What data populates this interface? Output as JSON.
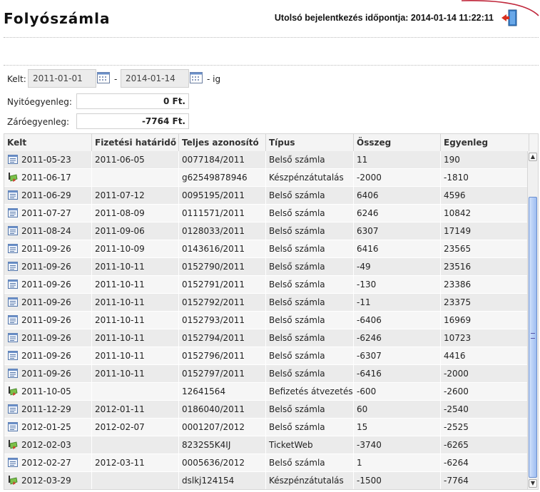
{
  "page": {
    "title": "Folyószámla",
    "last_login_label": "Utolsó bejelentkezés időpontja:",
    "last_login_value": "2014-01-14 11:22:11"
  },
  "filter": {
    "kelt_label": "Kelt:",
    "date_from": "2011-01-01",
    "separator": "-",
    "date_to": "2014-01-14",
    "suffix": "- ig",
    "opening_label": "Nyitóegyenleg:",
    "opening_value": "0 Ft.",
    "closing_label": "Záróegyenleg:",
    "closing_value": "-7764 Ft."
  },
  "table": {
    "columns": [
      "Kelt",
      "Fizetési határidő",
      "Teljes azonosító",
      "Típus",
      "Összeg",
      "Egyenleg"
    ],
    "rows": [
      {
        "icon": "invoice-icon",
        "kelt": "2011-05-23",
        "hatarido": "2011-06-05",
        "azonosito": "0077184/2011",
        "tipus": "Belső számla",
        "osszeg": "11",
        "egyenleg": "190"
      },
      {
        "icon": "payment-icon",
        "kelt": "2011-06-17",
        "hatarido": "",
        "azonosito": "g62549878946",
        "tipus": "Készpénzátutalás",
        "osszeg": "-2000",
        "egyenleg": "-1810"
      },
      {
        "icon": "invoice-icon",
        "kelt": "2011-06-29",
        "hatarido": "2011-07-12",
        "azonosito": "0095195/2011",
        "tipus": "Belső számla",
        "osszeg": "6406",
        "egyenleg": "4596"
      },
      {
        "icon": "invoice-icon",
        "kelt": "2011-07-27",
        "hatarido": "2011-08-09",
        "azonosito": "0111571/2011",
        "tipus": "Belső számla",
        "osszeg": "6246",
        "egyenleg": "10842"
      },
      {
        "icon": "invoice-icon",
        "kelt": "2011-08-24",
        "hatarido": "2011-09-06",
        "azonosito": "0128033/2011",
        "tipus": "Belső számla",
        "osszeg": "6307",
        "egyenleg": "17149"
      },
      {
        "icon": "invoice-icon",
        "kelt": "2011-09-26",
        "hatarido": "2011-10-09",
        "azonosito": "0143616/2011",
        "tipus": "Belső számla",
        "osszeg": "6416",
        "egyenleg": "23565"
      },
      {
        "icon": "invoice-icon",
        "kelt": "2011-09-26",
        "hatarido": "2011-10-11",
        "azonosito": "0152790/2011",
        "tipus": "Belső számla",
        "osszeg": "-49",
        "egyenleg": "23516"
      },
      {
        "icon": "invoice-icon",
        "kelt": "2011-09-26",
        "hatarido": "2011-10-11",
        "azonosito": "0152791/2011",
        "tipus": "Belső számla",
        "osszeg": "-130",
        "egyenleg": "23386"
      },
      {
        "icon": "invoice-icon",
        "kelt": "2011-09-26",
        "hatarido": "2011-10-11",
        "azonosito": "0152792/2011",
        "tipus": "Belső számla",
        "osszeg": "-11",
        "egyenleg": "23375"
      },
      {
        "icon": "invoice-icon",
        "kelt": "2011-09-26",
        "hatarido": "2011-10-11",
        "azonosito": "0152793/2011",
        "tipus": "Belső számla",
        "osszeg": "-6406",
        "egyenleg": "16969"
      },
      {
        "icon": "invoice-icon",
        "kelt": "2011-09-26",
        "hatarido": "2011-10-11",
        "azonosito": "0152794/2011",
        "tipus": "Belső számla",
        "osszeg": "-6246",
        "egyenleg": "10723"
      },
      {
        "icon": "invoice-icon",
        "kelt": "2011-09-26",
        "hatarido": "2011-10-11",
        "azonosito": "0152796/2011",
        "tipus": "Belső számla",
        "osszeg": "-6307",
        "egyenleg": "4416"
      },
      {
        "icon": "invoice-icon",
        "kelt": "2011-09-26",
        "hatarido": "2011-10-11",
        "azonosito": "0152797/2011",
        "tipus": "Belső számla",
        "osszeg": "-6416",
        "egyenleg": "-2000"
      },
      {
        "icon": "payment-icon",
        "kelt": "2011-10-05",
        "hatarido": "",
        "azonosito": "12641564",
        "tipus": "Befizetés átvezetés",
        "osszeg": "-600",
        "egyenleg": "-2600"
      },
      {
        "icon": "invoice-icon",
        "kelt": "2011-12-29",
        "hatarido": "2012-01-11",
        "azonosito": "0186040/2011",
        "tipus": "Belső számla",
        "osszeg": "60",
        "egyenleg": "-2540"
      },
      {
        "icon": "invoice-icon",
        "kelt": "2012-01-25",
        "hatarido": "2012-02-07",
        "azonosito": "0001207/2012",
        "tipus": "Belső számla",
        "osszeg": "15",
        "egyenleg": "-2525"
      },
      {
        "icon": "payment-icon",
        "kelt": "2012-02-03",
        "hatarido": "",
        "azonosito": "8232S5K4IJ",
        "tipus": "TicketWeb",
        "osszeg": "-3740",
        "egyenleg": "-6265"
      },
      {
        "icon": "invoice-icon",
        "kelt": "2012-02-27",
        "hatarido": "2012-03-11",
        "azonosito": "0005636/2012",
        "tipus": "Belső számla",
        "osszeg": "1",
        "egyenleg": "-6264"
      },
      {
        "icon": "payment-icon",
        "kelt": "2012-03-29",
        "hatarido": "",
        "azonosito": "dslkj124154",
        "tipus": "Készpénzátutalás",
        "osszeg": "-1500",
        "egyenleg": "-7764"
      }
    ]
  },
  "colors": {
    "accent_arc": "#c0283c",
    "scroll_thumb": "#9ebcf0"
  }
}
